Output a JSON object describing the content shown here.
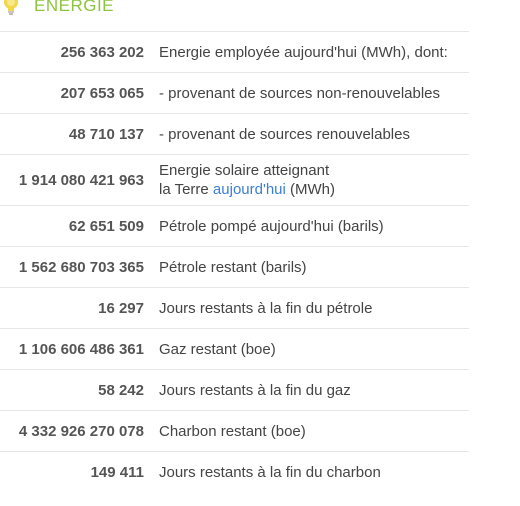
{
  "section": {
    "title": "ÉNERGIE",
    "icon": "lightbulb-icon",
    "title_color": "#8cc43f"
  },
  "rows": [
    {
      "value": "256 363 202",
      "label": "Energie employée aujourd'hui (MWh), dont:"
    },
    {
      "value": "207 653 065",
      "label": "- provenant de sources non-renouvelables"
    },
    {
      "value": "48 710 137",
      "label": "- provenant de sources renouvelables"
    },
    {
      "value": "1 914 080 421 963",
      "label_line1": "Energie solaire atteignant",
      "label_line2_prefix": "la Terre",
      "label_link": "aujourd'hui",
      "label_line2_suffix": "(MWh)"
    },
    {
      "value": "62 651 509",
      "label": "Pétrole pompé aujourd'hui (barils)"
    },
    {
      "value": "1 562 680 703 365",
      "label": "Pétrole restant (barils)"
    },
    {
      "value": "16 297",
      "label": "Jours restants à la fin du pétrole"
    },
    {
      "value": "1 106 606 486 361",
      "label": "Gaz restant (boe)"
    },
    {
      "value": "58 242",
      "label": "Jours restants à la fin du gaz"
    },
    {
      "value": "4 332 926 270 078",
      "label": "Charbon restant (boe)"
    },
    {
      "value": "149 411",
      "label": "Jours restants à la fin du charbon"
    }
  ]
}
